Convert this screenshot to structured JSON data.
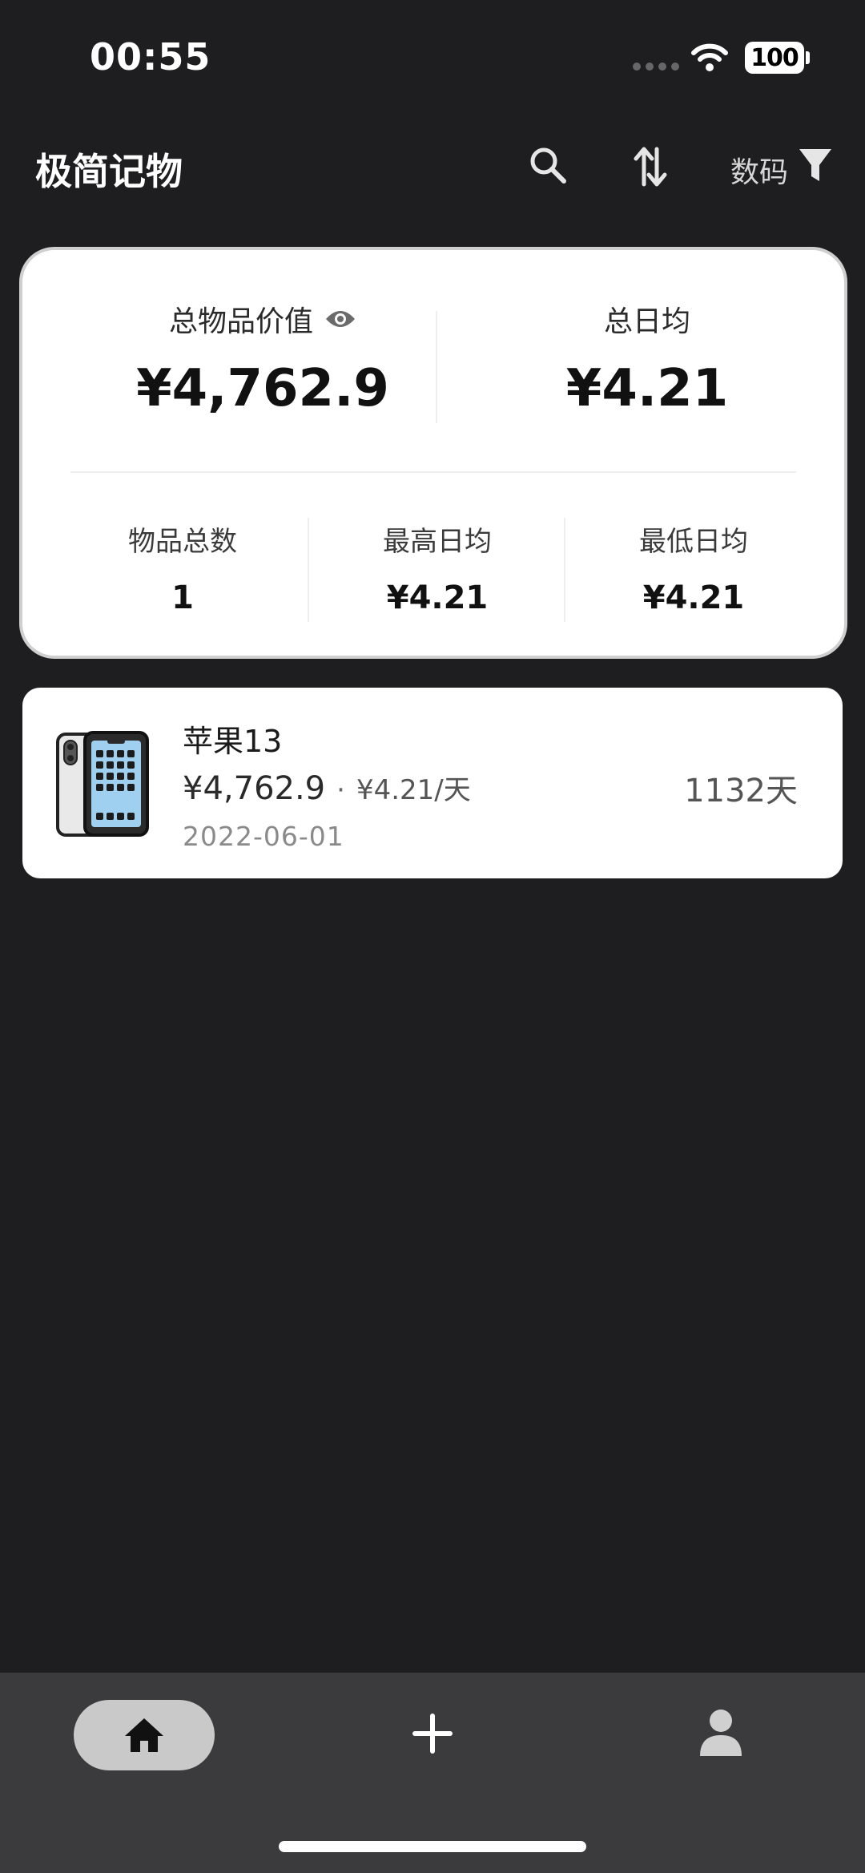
{
  "status_bar": {
    "time": "00:55",
    "battery": "100"
  },
  "header": {
    "title": "极简记物",
    "filter_label": "数码"
  },
  "summary": {
    "total_value_label": "总物品价值",
    "total_value": "¥4,762.9",
    "total_daily_label": "总日均",
    "total_daily": "¥4.21",
    "stats": [
      {
        "label": "物品总数",
        "value": "1"
      },
      {
        "label": "最高日均",
        "value": "¥4.21"
      },
      {
        "label": "最低日均",
        "value": "¥4.21"
      }
    ]
  },
  "items": [
    {
      "name": "苹果13",
      "price": "¥4,762.9",
      "separator": "·",
      "daily": "¥4.21/天",
      "date": "2022-06-01",
      "days": "1132天",
      "icon": "iphone-icon"
    }
  ],
  "tabbar": {
    "tabs": [
      "home-icon",
      "plus-icon",
      "person-icon"
    ],
    "active": "home-icon"
  },
  "colors": {
    "background": "#1e1e20",
    "card": "#ffffff",
    "tabbar": "#3b3a3c",
    "active_tab": "#c9c9c9"
  }
}
